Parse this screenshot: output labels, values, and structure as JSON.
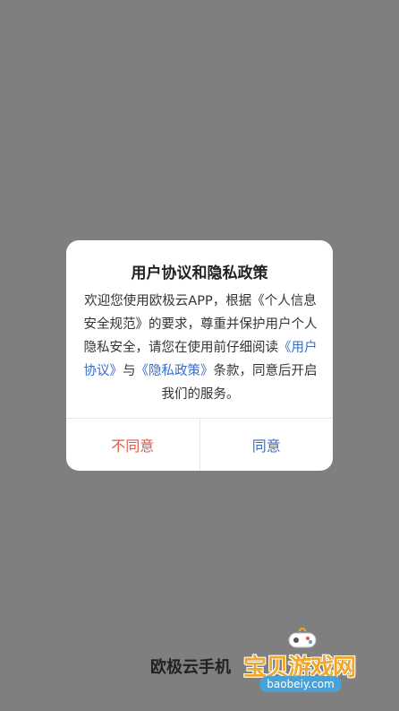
{
  "dialog": {
    "title": "用户协议和隐私政策",
    "body_part1": "欢迎您使用欧极云APP，根据《个人信息安全规范》的要求，尊重并保护用户个人隐私安全，请您在使用前仔细阅读",
    "link_user_agreement": "《用户协议》",
    "body_and": "与",
    "link_privacy_policy": "《隐私政策》",
    "body_part2": "条款，同意后开启我们的服务。",
    "disagree_label": "不同意",
    "agree_label": "同意"
  },
  "footer": {
    "app_name_partial": "欧极云手机"
  },
  "watermark": {
    "text": "宝贝游戏网",
    "url": "baobeiy.com"
  },
  "colors": {
    "overlay": "#7f7f7f",
    "link": "#3a6cc6",
    "disagree": "#e05a4a",
    "watermark": "#f1a72a"
  }
}
